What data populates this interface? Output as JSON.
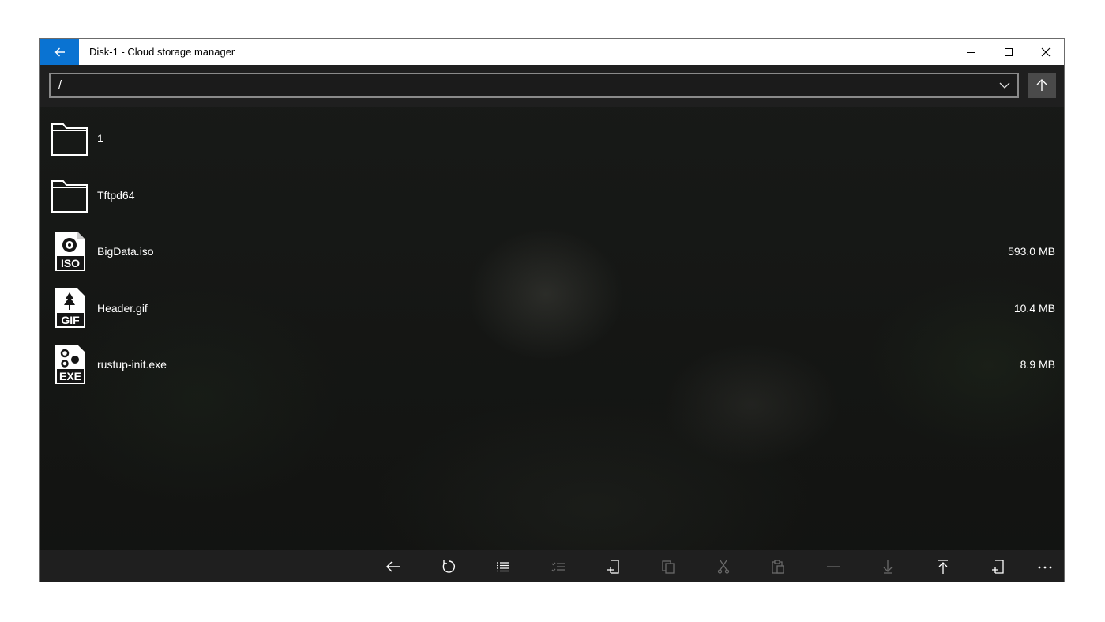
{
  "window": {
    "title": "Disk-1 - Cloud storage manager",
    "accent_color": "#0a73d2",
    "controls": [
      "minimize-icon",
      "maximize-icon",
      "close-icon"
    ]
  },
  "pathbar": {
    "path": "/",
    "dropdown_icon": "chevron-down-icon",
    "up_icon": "arrow-up-icon"
  },
  "files": [
    {
      "name": "1",
      "size": "",
      "icon": "folder-icon"
    },
    {
      "name": "Tftpd64",
      "size": "",
      "icon": "folder-icon"
    },
    {
      "name": "BigData.iso",
      "size": "593.0 MB",
      "icon": "iso-file-icon",
      "badge": "ISO"
    },
    {
      "name": "Header.gif",
      "size": "10.4 MB",
      "icon": "gif-file-icon",
      "badge": "GIF"
    },
    {
      "name": "rustup-init.exe",
      "size": "8.9 MB",
      "icon": "exe-file-icon",
      "badge": "EXE"
    }
  ],
  "toolbar": [
    {
      "icon": "back-arrow-icon",
      "enabled": true
    },
    {
      "icon": "refresh-icon",
      "enabled": true
    },
    {
      "icon": "list-view-icon",
      "enabled": true
    },
    {
      "icon": "select-list-icon",
      "enabled": false
    },
    {
      "icon": "new-item-icon",
      "enabled": true
    },
    {
      "icon": "copy-icon",
      "enabled": false
    },
    {
      "icon": "cut-icon",
      "enabled": false
    },
    {
      "icon": "paste-icon",
      "enabled": false
    },
    {
      "icon": "remove-icon",
      "enabled": false
    },
    {
      "icon": "download-icon",
      "enabled": false
    },
    {
      "icon": "upload-icon",
      "enabled": true
    },
    {
      "icon": "new-file-icon",
      "enabled": true
    },
    {
      "icon": "more-icon",
      "enabled": true
    }
  ]
}
